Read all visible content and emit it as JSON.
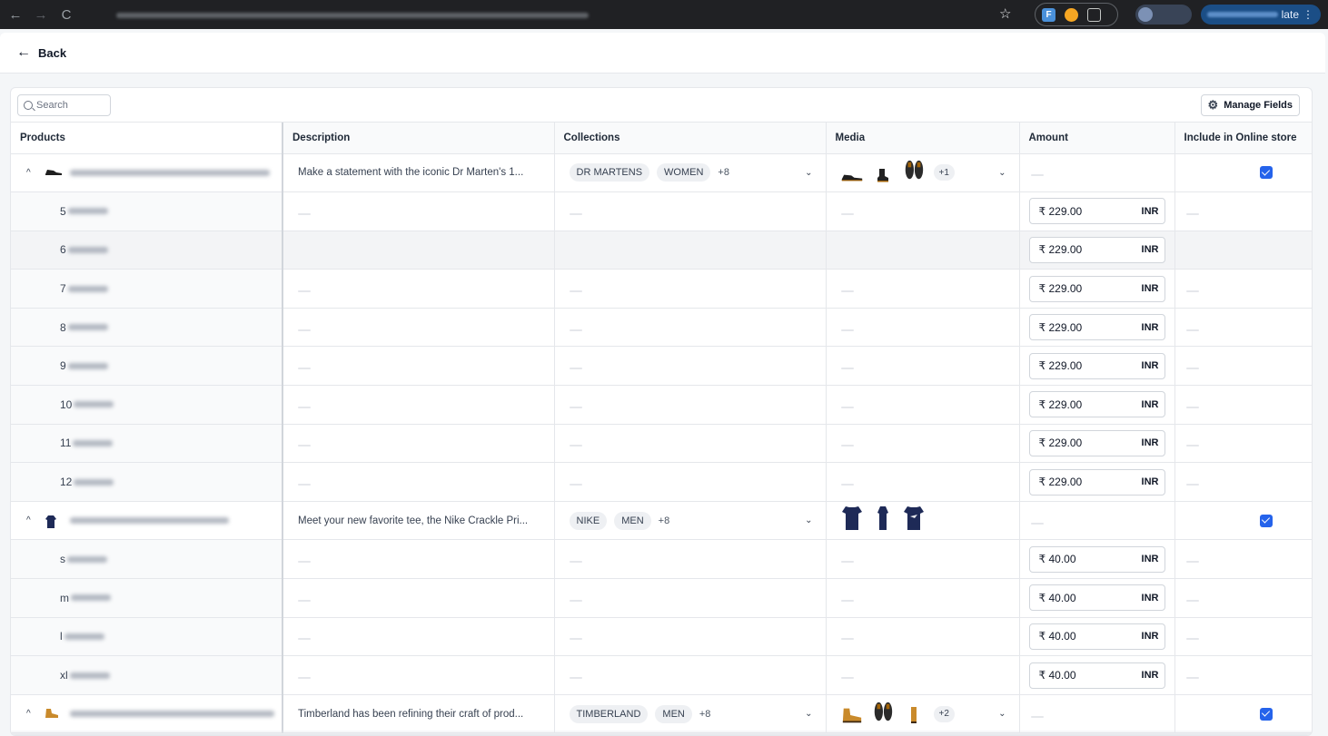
{
  "browser": {
    "back_glyph": "←",
    "forward_glyph": "→",
    "reload_glyph": "C",
    "star_glyph": "☆",
    "ext1": "F",
    "update_suffix": "late",
    "menu_glyph": "⋮"
  },
  "nav": {
    "back_label": "Back"
  },
  "toolbar": {
    "search_placeholder": "Search",
    "manage_fields_label": "Manage Fields"
  },
  "columns": {
    "products": "Products",
    "description": "Description",
    "collections": "Collections",
    "media": "Media",
    "amount": "Amount",
    "online_store": "Include in Online store"
  },
  "products": [
    {
      "description": "Make a statement with the iconic Dr Marten's 1...",
      "collections": [
        "DR MARTENS",
        "WOMEN"
      ],
      "collections_more": "+8",
      "media_more": "+1",
      "media_icons": [
        "boot-low-icon",
        "boot-high-icon",
        "boot-pair-icon"
      ],
      "included": true,
      "variants": [
        {
          "size": "5",
          "amount": "₹ 229.00",
          "currency": "INR"
        },
        {
          "size": "6",
          "amount": "₹ 229.00",
          "currency": "INR"
        },
        {
          "size": "7",
          "amount": "₹ 229.00",
          "currency": "INR"
        },
        {
          "size": "8",
          "amount": "₹ 229.00",
          "currency": "INR"
        },
        {
          "size": "9",
          "amount": "₹ 229.00",
          "currency": "INR"
        },
        {
          "size": "10",
          "amount": "₹ 229.00",
          "currency": "INR"
        },
        {
          "size": "11",
          "amount": "₹ 229.00",
          "currency": "INR"
        },
        {
          "size": "12",
          "amount": "₹ 229.00",
          "currency": "INR"
        }
      ]
    },
    {
      "description": "Meet your new favorite tee, the Nike Crackle Pri...",
      "collections": [
        "NIKE",
        "MEN"
      ],
      "collections_more": "+8",
      "media_more": "",
      "media_icons": [
        "tshirt-front-icon",
        "tshirt-side-icon",
        "tshirt-back-icon"
      ],
      "included": true,
      "variants": [
        {
          "size": "s",
          "amount": "₹ 40.00",
          "currency": "INR"
        },
        {
          "size": "m",
          "amount": "₹ 40.00",
          "currency": "INR"
        },
        {
          "size": "l",
          "amount": "₹ 40.00",
          "currency": "INR"
        },
        {
          "size": "xl",
          "amount": "₹ 40.00",
          "currency": "INR"
        }
      ]
    },
    {
      "description": "Timberland has been refining their craft of prod...",
      "collections": [
        "TIMBERLAND",
        "MEN"
      ],
      "collections_more": "+8",
      "media_more": "+2",
      "media_icons": [
        "boot-side-icon",
        "boot-pair-icon",
        "boot-back-icon"
      ],
      "included": true,
      "variants": []
    }
  ]
}
